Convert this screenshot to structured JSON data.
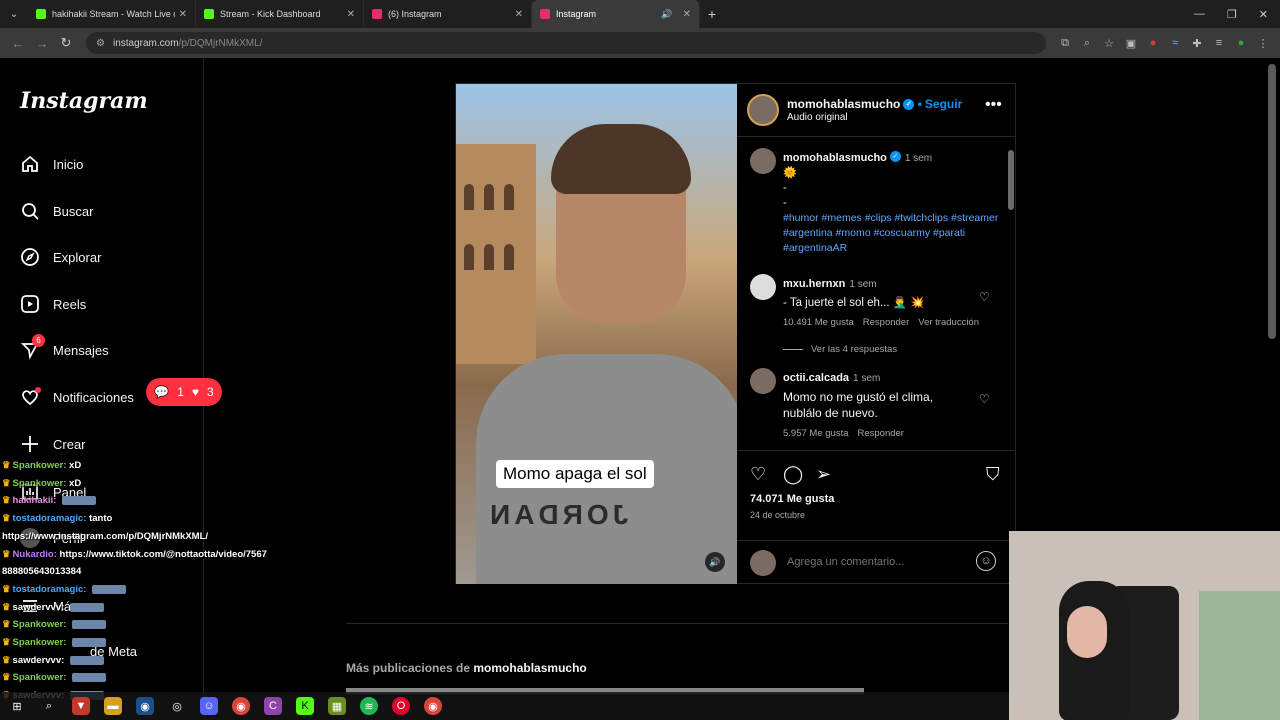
{
  "browser": {
    "tabs": [
      {
        "title": "hakihakii Stream - Watch Live o",
        "favicon_color": "#53fc18"
      },
      {
        "title": "Stream - Kick Dashboard",
        "favicon_color": "#53fc18"
      },
      {
        "title": "(6) Instagram",
        "favicon_color": "#e1306c"
      },
      {
        "title": "Instagram",
        "favicon_color": "#e1306c",
        "active": true
      }
    ],
    "url_host": "instagram.com",
    "url_path": "/p/DQMjrNMkXML/"
  },
  "sidebar": {
    "logo": "Instagram",
    "items": [
      {
        "label": "Inicio",
        "icon": "home-icon"
      },
      {
        "label": "Buscar",
        "icon": "search-icon"
      },
      {
        "label": "Explorar",
        "icon": "compass-icon"
      },
      {
        "label": "Reels",
        "icon": "reels-icon"
      },
      {
        "label": "Mensajes",
        "icon": "messenger-icon",
        "badge": "6"
      },
      {
        "label": "Notificaciones",
        "icon": "heart-icon"
      },
      {
        "label": "Crear",
        "icon": "plus-icon"
      },
      {
        "label": "Panel",
        "icon": "dashboard-icon"
      },
      {
        "label": "Perfil",
        "icon": "profile-icon"
      },
      {
        "label": "Más",
        "icon": "menu-icon"
      },
      {
        "label": "de Meta",
        "icon": "meta-icon"
      }
    ],
    "notif_pill": {
      "comments": "1",
      "likes": "3"
    }
  },
  "post": {
    "video_caption": "Momo apaga el sol",
    "shirt_text": "JORDAN",
    "header": {
      "username": "momohablasmucho",
      "follow": "Seguir",
      "audio": "Audio original"
    },
    "caption": {
      "username": "momohablasmucho",
      "time": "1 sem",
      "emoji": "🌞",
      "lines": [
        "-",
        "-"
      ],
      "hashtags": "#humor #memes #clips #twitchclips #streamer #argentina #momo #coscuarmy #parati #argentinaAR"
    },
    "comments": [
      {
        "username": "mxu.hernxn",
        "time": "1 sem",
        "text": "- Ta juerte el sol eh... 🤦‍♂️ 💥",
        "likes": "10.491 Me gusta",
        "reply": "Responder",
        "translate": "Ver traducción",
        "view_replies": "Ver las 4 respuestas"
      },
      {
        "username": "octii.calcada",
        "time": "1 sem",
        "text": "Momo no me gustó el clima, nublálo de nuevo.",
        "likes": "5.957 Me gusta",
        "reply": "Responder"
      }
    ],
    "likes_count": "74.071 Me gusta",
    "date": "24 de octubre",
    "add_comment_placeholder": "Agrega un comentario..."
  },
  "more_posts": {
    "prefix": "Más publicaciones de",
    "username": "momohablasmucho"
  },
  "chat": [
    {
      "user": "Spankower:",
      "color": "#7fd24a",
      "msg": "xD"
    },
    {
      "user": "Spankower:",
      "color": "#7fd24a",
      "msg": "xD"
    },
    {
      "user": "hakihakii:",
      "color": "#e58fe0",
      "msg": ""
    },
    {
      "user": "tostadoramagic:",
      "color": "#4ba8ff",
      "msg": "tanto"
    },
    {
      "user": "",
      "color": "#ffffff",
      "msg": "https://www.instagram.com/p/DQMjrNMkXML/"
    },
    {
      "user": "Nukardio:",
      "color": "#c07cff",
      "msg": "https://www.tiktok.com/@nottaotta/video/7567"
    },
    {
      "user": "",
      "color": "#ffffff",
      "msg": "888805643013384"
    },
    {
      "user": "tostadoramagic:",
      "color": "#4ba8ff",
      "msg": ""
    },
    {
      "user": "sawdervvv:",
      "color": "#ffffff",
      "msg": ""
    },
    {
      "user": "Spankower:",
      "color": "#7fd24a",
      "msg": ""
    },
    {
      "user": "Spankower:",
      "color": "#7fd24a",
      "msg": ""
    },
    {
      "user": "sawdervvv:",
      "color": "#ffffff",
      "msg": ""
    },
    {
      "user": "Spankower:",
      "color": "#7fd24a",
      "msg": ""
    },
    {
      "user": "sawdervvv:",
      "color": "#ffffff",
      "msg": ""
    }
  ]
}
